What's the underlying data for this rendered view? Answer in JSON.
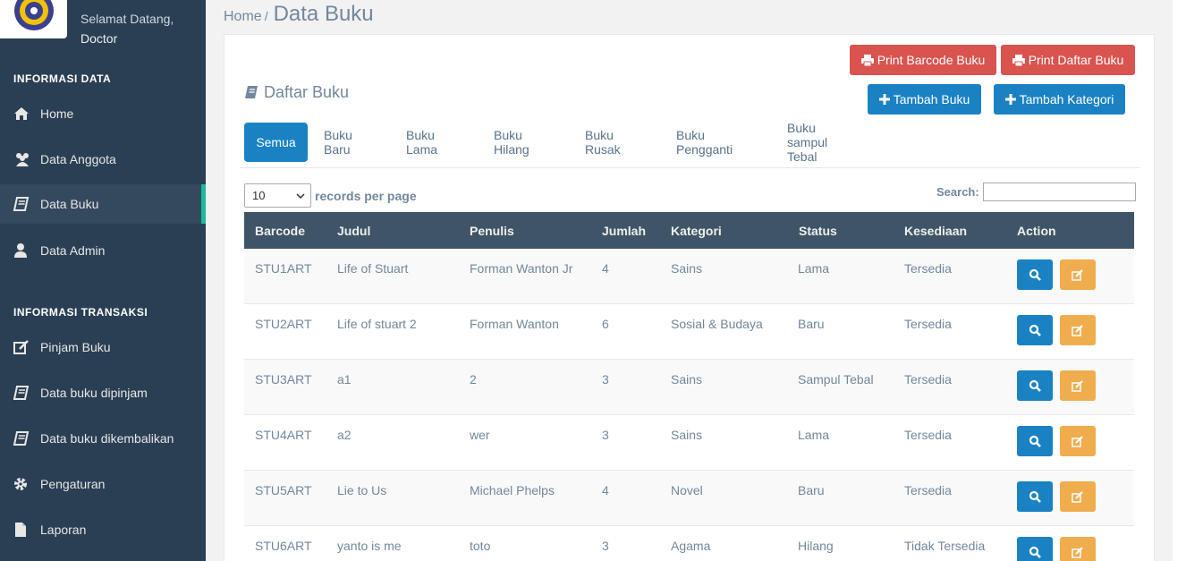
{
  "sidebar": {
    "welcome": "Selamat Datang,",
    "user": "Doctor",
    "section1": "INFORMASI DATA",
    "section2": "INFORMASI TRANSAKSI",
    "items": [
      {
        "label": "Home",
        "icon": "home-icon"
      },
      {
        "label": "Data Anggota",
        "icon": "users-icon"
      },
      {
        "label": "Data Buku",
        "icon": "book-icon"
      },
      {
        "label": "Data Admin",
        "icon": "user-icon"
      },
      {
        "label": "Pinjam Buku",
        "icon": "edit-icon"
      },
      {
        "label": "Data buku dipinjam",
        "icon": "book-icon"
      },
      {
        "label": "Data buku dikembalikan",
        "icon": "book-icon"
      },
      {
        "label": "Pengaturan",
        "icon": "gear-icon"
      },
      {
        "label": "Laporan",
        "icon": "file-icon"
      }
    ],
    "active": "Data Buku"
  },
  "breadcrumb": {
    "home": "Home",
    "sep": "/",
    "title": "Data Buku"
  },
  "panel": {
    "title": "Daftar Buku",
    "buttons": {
      "print_barcode": "Print Barcode Buku",
      "print_list": "Print Daftar Buku",
      "add_book": "Tambah Buku",
      "add_category": "Tambah Kategori"
    },
    "tabs": [
      "Semua",
      "Buku Baru",
      "Buku Lama",
      "Buku Hilang",
      "Buku Rusak",
      "Buku Pengganti",
      "Buku sampul Tebal"
    ],
    "active_tab": "Semua",
    "length": {
      "value": "10",
      "label": "records per page"
    },
    "search": {
      "label": "Search:",
      "value": ""
    }
  },
  "table": {
    "headers": [
      "Barcode",
      "Judul",
      "Penulis",
      "Jumlah",
      "Kategori",
      "Status",
      "Kesediaan",
      "Action"
    ],
    "rows": [
      [
        "STU1ART",
        "Life of Stuart",
        "Forman Wanton Jr",
        "4",
        "Sains",
        "Lama",
        "Tersedia"
      ],
      [
        "STU2ART",
        "Life of stuart 2",
        "Forman Wanton",
        "6",
        "Sosial & Budaya",
        "Baru",
        "Tersedia"
      ],
      [
        "STU3ART",
        "a1",
        "2",
        "3",
        "Sains",
        "Sampul Tebal",
        "Tersedia"
      ],
      [
        "STU4ART",
        "a2",
        "wer",
        "3",
        "Sains",
        "Lama",
        "Tersedia"
      ],
      [
        "STU5ART",
        "Lie to Us",
        "Michael Phelps",
        "4",
        "Novel",
        "Baru",
        "Tersedia"
      ],
      [
        "STU6ART",
        "yanto is me",
        "toto",
        "3",
        "Agama",
        "Hilang",
        "Tidak Tersedia"
      ]
    ]
  },
  "colors": {
    "sidebar": "#2a3f54",
    "accent": "#1abb9c",
    "primary": "#1a82c3",
    "danger": "#d9534f",
    "warning": "#f0ad4e",
    "table_header": "#405467"
  }
}
